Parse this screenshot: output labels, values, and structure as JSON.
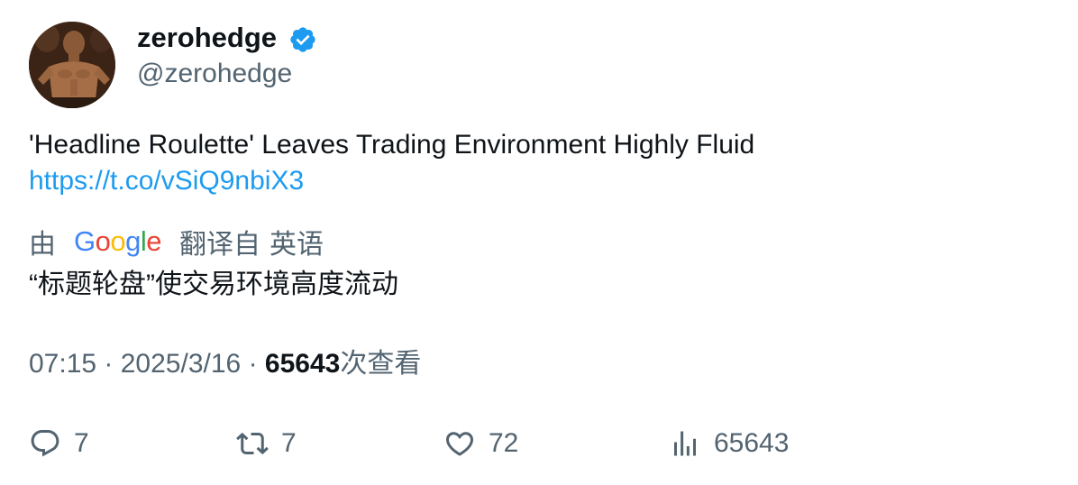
{
  "author": {
    "display_name": "zerohedge",
    "handle": "@zerohedge",
    "verified": true,
    "verified_color": "#1d9bf0"
  },
  "tweet": {
    "text": "'Headline Roulette' Leaves Trading Environment Highly Fluid",
    "link": "https://t.co/vSiQ9nbiX3",
    "link_color": "#1d9bf0"
  },
  "translation": {
    "prefix": "由",
    "provider": "Google",
    "label": "翻译自",
    "source_language": "英语",
    "text": "“标题轮盘”使交易环境高度流动"
  },
  "meta": {
    "time": "07:15",
    "separator": "·",
    "date": "2025/3/16",
    "views_count": "65643",
    "views_label": "次查看"
  },
  "actions": {
    "reply": {
      "icon": "reply-icon",
      "count": "7"
    },
    "retweet": {
      "icon": "retweet-icon",
      "count": "7"
    },
    "like": {
      "icon": "heart-icon",
      "count": "72"
    },
    "views": {
      "icon": "bar-chart-icon",
      "count": "65643"
    }
  },
  "colors": {
    "text_primary": "#0f1419",
    "text_secondary": "#536471",
    "accent": "#1d9bf0"
  }
}
